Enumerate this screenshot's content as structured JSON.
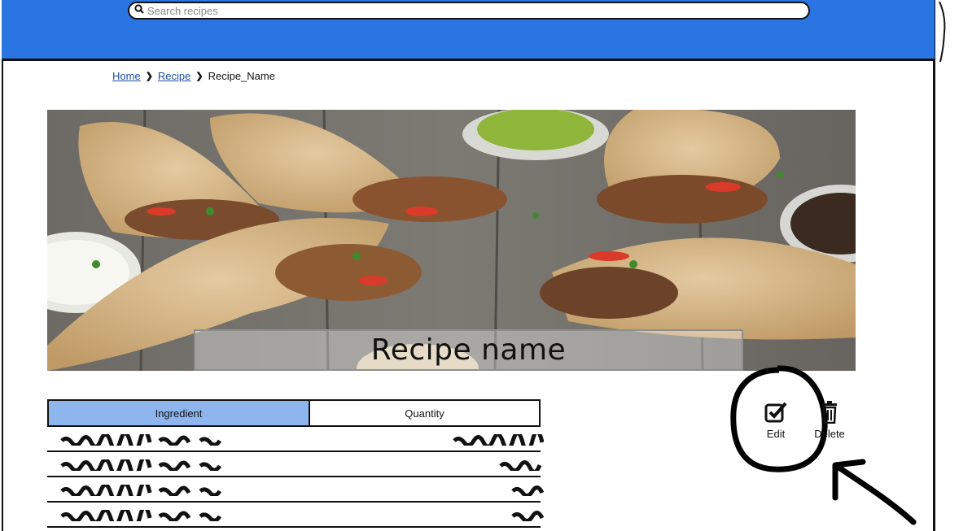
{
  "search": {
    "placeholder": "Search recipes"
  },
  "breadcrumb": {
    "home": "Home",
    "recipe": "Recipe",
    "current": "Recipe_Name"
  },
  "hero": {
    "title": "Recipe name"
  },
  "table": {
    "headers": [
      "Ingredient",
      "Quantity"
    ],
    "row_count": 4
  },
  "actions": {
    "edit": "Edit",
    "delete": "Delete"
  },
  "colors": {
    "header": "#2b75e3",
    "table_header": "#8fb5ef"
  },
  "icons": [
    "search-icon",
    "chevron-right-icon",
    "checkbox-icon",
    "trash-icon"
  ]
}
